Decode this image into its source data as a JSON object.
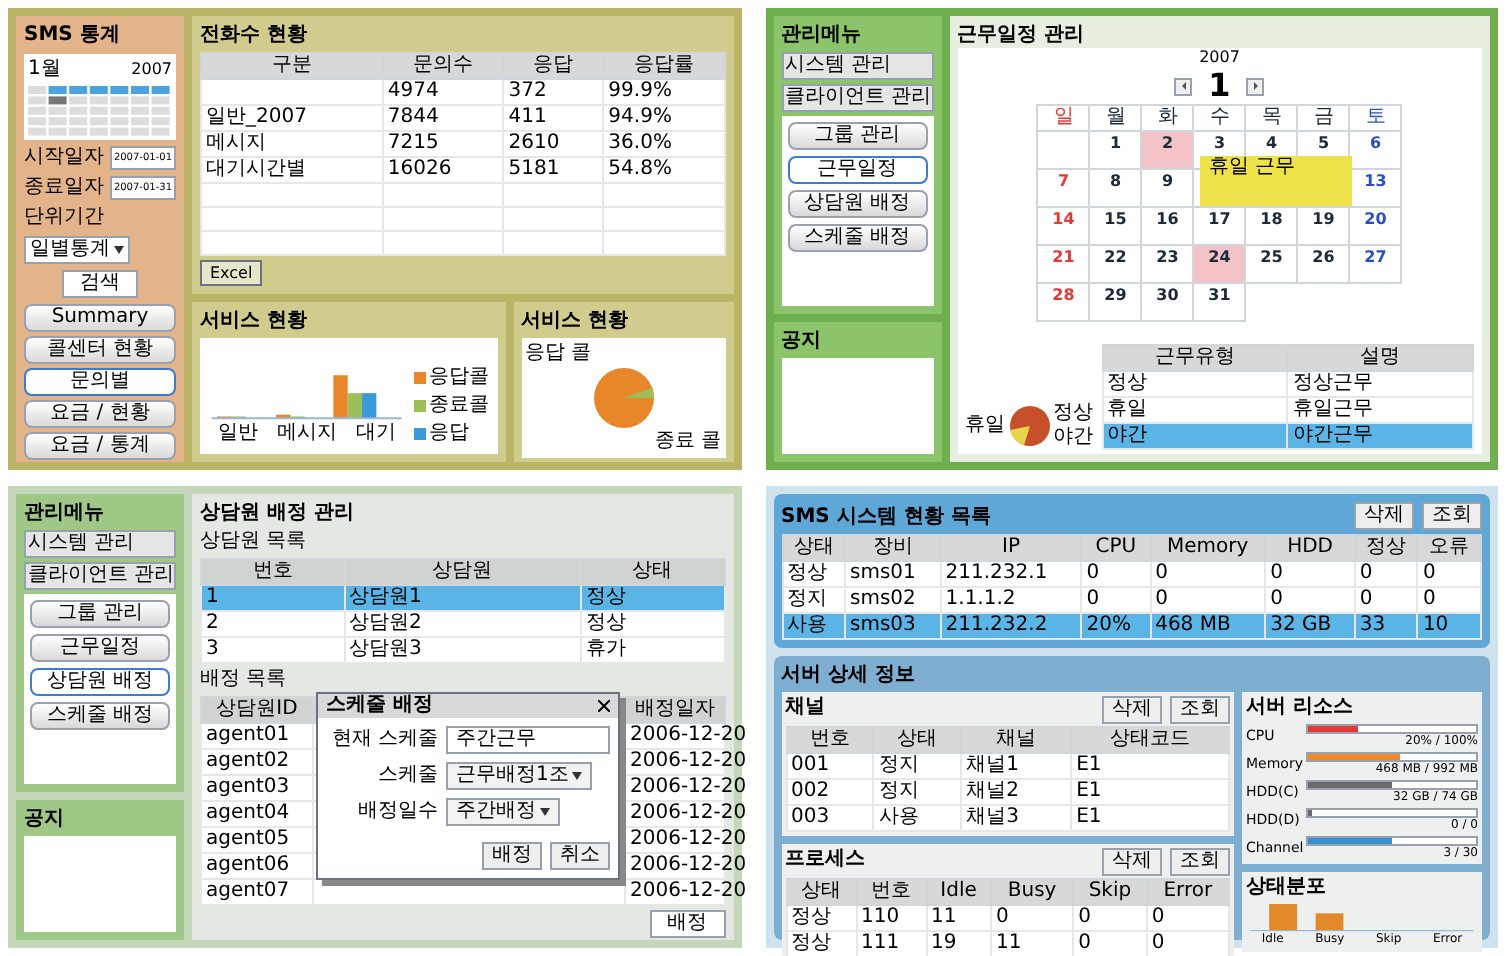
{
  "report": {
    "title": "SMS 통계",
    "calendar": {
      "month": "1월",
      "year": "2007"
    },
    "fields": [
      {
        "label": "시작일자",
        "value": "2007-01-01"
      },
      {
        "label": "종료일자",
        "value": "2007-01-31"
      }
    ],
    "period": {
      "label": "단위기간",
      "value": "일별통계"
    },
    "search_button": "검색",
    "menu": [
      {
        "label": "Summary",
        "selected": false
      },
      {
        "label": "콜센터 현황",
        "selected": false
      },
      {
        "label": "문의별",
        "selected": true
      },
      {
        "label": "요금 / 현황",
        "selected": false
      },
      {
        "label": "요금 / 통계",
        "selected": false
      }
    ],
    "table": {
      "title": "전화수 현황",
      "columns": [
        "구분",
        "문의수",
        "응답",
        "응답률"
      ],
      "rows": [
        {
          "cells": [
            "",
            "4974",
            "372",
            "99.9%"
          ]
        },
        {
          "cells": [
            "일반_2007",
            "7844",
            "411",
            "94.9%"
          ]
        },
        {
          "cells": [
            "메시지",
            "7215",
            "2610",
            "36.0%"
          ]
        },
        {
          "cells": [
            "대기시간별",
            "16026",
            "5181",
            "54.8%"
          ]
        }
      ]
    },
    "excel_button": "Excel",
    "bar_chart": {
      "title": "서비스 현황",
      "categories": [
        "일반",
        "메시지",
        "대기"
      ],
      "legend": [
        {
          "label": "응답콜",
          "color": "#e8862a"
        },
        {
          "label": "종료콜",
          "color": "#9cbf5a"
        },
        {
          "label": "응답",
          "color": "#3a9ad9"
        }
      ]
    },
    "pie_chart": {
      "title": "서비스 현황",
      "labels": [
        "응답 콜",
        "종료 콜"
      ]
    }
  },
  "schedule": {
    "menu_title": "관리메뉴",
    "menu_tabs": [
      "시스템 관리",
      "클라이언트 관리"
    ],
    "buttons": [
      {
        "label": "그룹 관리",
        "selected": false
      },
      {
        "label": "근무일정",
        "selected": true
      },
      {
        "label": "상담원 배정",
        "selected": false
      },
      {
        "label": "스케줄 배정",
        "selected": false
      }
    ],
    "notice_title": "공지",
    "title": "근무일정 관리",
    "year": "2007",
    "month": "1",
    "weekdays": [
      "일",
      "월",
      "화",
      "수",
      "목",
      "금",
      "토"
    ],
    "weeks": [
      [
        {
          "day": "1",
          "marked": false
        },
        {
          "day": "2",
          "marked": true
        },
        {
          "day": "3",
          "marked": false
        },
        {
          "day": "4",
          "marked": false
        },
        {
          "day": "5",
          "marked": false
        },
        {
          "day": "6",
          "marked": false
        }
      ],
      [
        {
          "kind": "day",
          "day": "7",
          "marked": false
        },
        {
          "kind": "day",
          "day": "8",
          "marked": false
        },
        {
          "kind": "day",
          "day": "9",
          "marked": false
        },
        {
          "kind": "covered"
        },
        {
          "kind": "covered"
        },
        {
          "kind": "covered"
        },
        {
          "kind": "day",
          "day": "13",
          "marked": false
        }
      ],
      [
        {
          "day": "14",
          "marked": false
        },
        {
          "day": "15",
          "marked": false
        },
        {
          "day": "16",
          "marked": false
        },
        {
          "day": "17",
          "marked": false
        },
        {
          "day": "18",
          "marked": false
        },
        {
          "day": "19",
          "marked": false
        },
        {
          "day": "20",
          "marked": false
        }
      ],
      [
        {
          "day": "21",
          "marked": false
        },
        {
          "day": "22",
          "marked": false
        },
        {
          "day": "23",
          "marked": false
        },
        {
          "day": "24",
          "marked": true
        },
        {
          "day": "25",
          "marked": false
        },
        {
          "day": "26",
          "marked": false
        },
        {
          "day": "27",
          "marked": false
        }
      ],
      [
        {
          "day": "28",
          "marked": false
        },
        {
          "day": "29",
          "marked": false
        },
        {
          "day": "30",
          "marked": false
        },
        {
          "day": "31",
          "marked": false
        }
      ]
    ],
    "note": "휴일 근무",
    "pie_labels": [
      "휴일",
      "정상",
      "야간"
    ],
    "table": {
      "columns": [
        "근무유형",
        "설명"
      ],
      "rows": [
        {
          "cells": [
            "정상",
            "정상근무"
          ],
          "selected": false
        },
        {
          "cells": [
            "휴일",
            "휴일근무"
          ],
          "selected": false
        },
        {
          "cells": [
            "야간",
            "야간근무"
          ],
          "selected": true
        }
      ]
    }
  },
  "assign": {
    "menu_title": "관리메뉴",
    "menu_tabs": [
      "시스템 관리",
      "클라이언트 관리"
    ],
    "buttons": [
      {
        "label": "그룹 관리",
        "selected": false
      },
      {
        "label": "근무일정",
        "selected": false
      },
      {
        "label": "상담원 배정",
        "selected": true
      },
      {
        "label": "스케줄 배정",
        "selected": false
      }
    ],
    "notice_title": "공지",
    "title": "상담원 배정 관리",
    "list_title": "상담원 목록",
    "list": {
      "columns": [
        "번호",
        "상담원",
        "상태"
      ],
      "rows": [
        {
          "cells": [
            "1",
            "상담원1",
            "정상"
          ],
          "selected": true
        },
        {
          "cells": [
            "2",
            "상담원2",
            "정상"
          ],
          "selected": false
        },
        {
          "cells": [
            "3",
            "상담원3",
            "휴가"
          ],
          "selected": false
        }
      ]
    },
    "assigned_title": "배정 목록",
    "assigned": {
      "columns_left": [
        "상담원ID"
      ],
      "columns_right": [
        "배정일자"
      ],
      "rows": [
        {
          "left": [
            "agent01"
          ],
          "right": [
            "2006-12-20"
          ]
        },
        {
          "left": [
            "agent02"
          ],
          "right": [
            "2006-12-20"
          ]
        },
        {
          "left": [
            "agent03"
          ],
          "right": [
            "2006-12-20"
          ]
        },
        {
          "left": [
            "agent04"
          ],
          "right": [
            "2006-12-20"
          ]
        },
        {
          "left": [
            "agent05"
          ],
          "right": [
            "2006-12-20"
          ]
        },
        {
          "left": [
            "agent06"
          ],
          "right": [
            "2006-12-20"
          ]
        },
        {
          "left": [
            "agent07"
          ],
          "right": [
            "2006-12-20"
          ]
        }
      ]
    },
    "assign_button": "배정",
    "dialog": {
      "title": "스케줄 배정",
      "fields": [
        {
          "kind": "text",
          "label": "현재 스케줄",
          "value": "주간근무"
        },
        {
          "kind": "select",
          "label": "스케줄",
          "value": "근무배정1조"
        },
        {
          "kind": "select",
          "label": "배정일수",
          "value": "주간배정"
        }
      ],
      "buttons": [
        "배정",
        "취소"
      ]
    }
  },
  "monitor": {
    "title": "SMS 시스템 현황 목록",
    "servers": {
      "columns": [
        "상태",
        "장비",
        "IP",
        "CPU",
        "Memory",
        "HDD",
        "정상",
        "오류"
      ],
      "rows": [
        {
          "cells": [
            "정상",
            "sms01",
            "211.232.1",
            "0",
            "0",
            "0",
            "0",
            "0"
          ],
          "selected": false
        },
        {
          "cells": [
            "정지",
            "sms02",
            "1.1.1.2",
            "0",
            "0",
            "0",
            "0",
            "0"
          ],
          "selected": false
        },
        {
          "cells": [
            "사용",
            "sms03",
            "211.232.2",
            "20%",
            "468 MB",
            "32 GB",
            "33",
            "10"
          ],
          "selected": true
        }
      ]
    },
    "server_buttons": [
      "삭제",
      "조회"
    ],
    "detail_title": "서버 상세 정보",
    "channel_title": "채널",
    "channels": {
      "columns": [
        "번호",
        "상태",
        "채널",
        "상태코드"
      ],
      "rows": [
        {
          "cells": [
            "001",
            "정지",
            "채널1",
            "E1"
          ]
        },
        {
          "cells": [
            "002",
            "정지",
            "채널2",
            "E1"
          ]
        },
        {
          "cells": [
            "003",
            "사용",
            "채널3",
            "E1"
          ]
        }
      ]
    },
    "channel_buttons": [
      "삭제",
      "조회"
    ],
    "process_title": "프로세스",
    "processes": {
      "columns": [
        "상태",
        "번호",
        "Idle",
        "Busy",
        "Skip",
        "Error"
      ],
      "rows": [
        {
          "cells": [
            "정상",
            "110",
            "11",
            "0",
            "0",
            "0"
          ]
        },
        {
          "cells": [
            "정상",
            "111",
            "19",
            "11",
            "0",
            "0"
          ]
        }
      ]
    },
    "process_buttons": [
      "삭제",
      "조회"
    ],
    "resource_title": "서버 리소스",
    "resources": [
      {
        "name": "CPU",
        "level": 0.3,
        "reading": "20% / 100%",
        "color": "#e53935"
      },
      {
        "name": "Memory",
        "level": 0.55,
        "reading": "468 MB / 992 MB",
        "color": "#ef8a2a"
      },
      {
        "name": "HDD(C)",
        "level": 0.5,
        "reading": "32 GB / 74 GB",
        "color": "#6b6b6b"
      },
      {
        "name": "HDD(D)",
        "level": 0,
        "reading": "0 / 0",
        "color": "#6b6b6b"
      },
      {
        "name": "Channel",
        "level": 0.5,
        "reading": "3 / 30",
        "color": "#3a8fd0"
      }
    ],
    "state_title": "상태분포",
    "state_labels": [
      "Idle",
      "Busy",
      "Skip",
      "Error"
    ]
  }
}
